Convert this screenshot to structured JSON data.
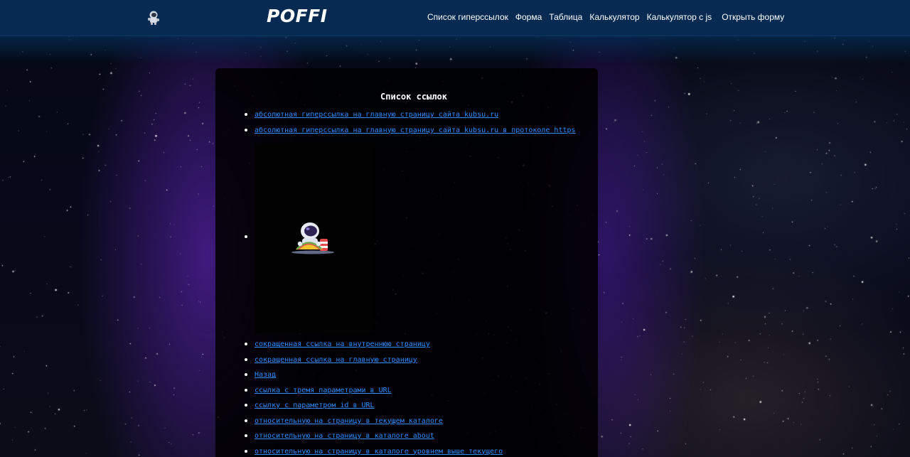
{
  "header": {
    "logo": "POFFI",
    "icon": "astronaut-icon",
    "nav": [
      "Список гиперссылок",
      "Форма",
      "Таблица",
      "Калькулятор",
      "Калькулятор с js",
      "Открыть форму"
    ]
  },
  "main": {
    "title": "Список ссылок",
    "links": [
      {
        "text": "абсолютная гиперссылка на главную страницу сайта kubsu.ru"
      },
      {
        "text": "абсолютная гиперссылка на главную страницу сайта kubsu.ru в протоколе https"
      },
      {
        "image": "astronaut-on-taco-icon"
      },
      {
        "text": "сокращенная ссылка на внутреннюю страницу"
      },
      {
        "text": "сокращенная ссылка на главную страницу"
      },
      {
        "text": "Назад"
      },
      {
        "text": "ссылка с тремя параметрами в URL"
      },
      {
        "text": "ссылку с параметром id в URL"
      },
      {
        "text": "относительную на страницу в текущем каталоге"
      },
      {
        "text": "относительную на страницу в каталоге about"
      },
      {
        "text": "относительную на страницу в каталоге уровнем выше текущего"
      }
    ]
  },
  "colors": {
    "header_bg": "#062a52",
    "link": "#2d8cff",
    "panel_bg": "#000000"
  }
}
